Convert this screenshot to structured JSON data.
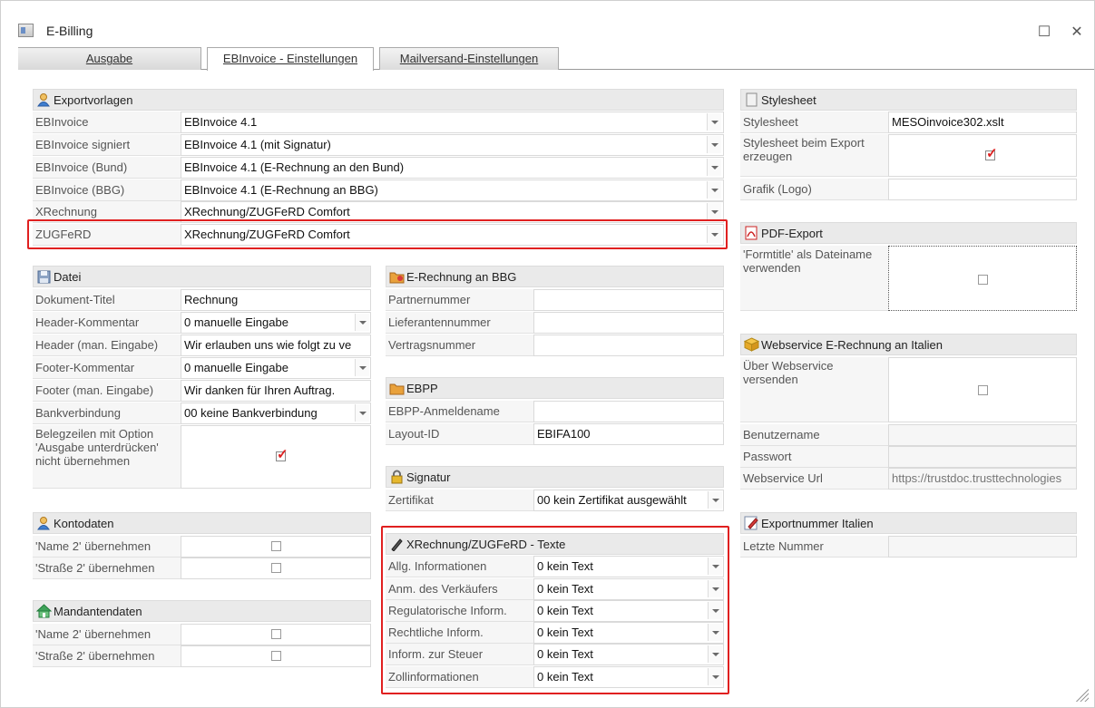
{
  "window": {
    "title": "E-Billing"
  },
  "tabs": [
    "Ausgabe",
    "EBInvoice - Einstellungen",
    "Mailversand-Einstellungen"
  ],
  "exportvorlagen": {
    "title": "Exportvorlagen",
    "rows": [
      {
        "label": "EBInvoice",
        "value": "EBInvoice 4.1"
      },
      {
        "label": "EBInvoice signiert",
        "value": "EBInvoice 4.1 (mit Signatur)"
      },
      {
        "label": "EBInvoice (Bund)",
        "value": "EBInvoice 4.1 (E-Rechnung an den Bund)"
      },
      {
        "label": "EBInvoice (BBG)",
        "value": "EBInvoice 4.1 (E-Rechnung an BBG)"
      },
      {
        "label": "XRechnung",
        "value": "XRechnung/ZUGFeRD Comfort"
      },
      {
        "label": "ZUGFeRD",
        "value": "XRechnung/ZUGFeRD Comfort"
      }
    ]
  },
  "datei": {
    "title": "Datei",
    "rows": [
      {
        "label": "Dokument-Titel",
        "value": "Rechnung"
      },
      {
        "label": "Header-Kommentar",
        "value": "0  manuelle Eingabe"
      },
      {
        "label": "Header (man. Eingabe)",
        "value": "Wir erlauben uns wie folgt zu ve"
      },
      {
        "label": "Footer-Kommentar",
        "value": "0  manuelle Eingabe"
      },
      {
        "label": "Footer (man. Eingabe)",
        "value": "Wir danken für Ihren Auftrag."
      },
      {
        "label": "Bankverbindung",
        "value": "00  keine Bankverbindung"
      },
      {
        "label": "Belegzeilen mit Option 'Ausgabe unterdrücken' nicht übernehmen",
        "checked": true
      }
    ]
  },
  "kontodaten": {
    "title": "Kontodaten",
    "rows": [
      {
        "label": "'Name 2' übernehmen",
        "checked": false
      },
      {
        "label": "'Straße 2' übernehmen",
        "checked": false
      }
    ]
  },
  "mandantendaten": {
    "title": "Mandantendaten",
    "rows": [
      {
        "label": "'Name 2' übernehmen",
        "checked": false
      },
      {
        "label": "'Straße 2' übernehmen",
        "checked": false
      }
    ]
  },
  "bbg": {
    "title": "E-Rechnung an BBG",
    "rows": [
      {
        "label": "Partnernummer",
        "value": ""
      },
      {
        "label": "Lieferantennummer",
        "value": ""
      },
      {
        "label": "Vertragsnummer",
        "value": ""
      }
    ]
  },
  "ebpp": {
    "title": "EBPP",
    "rows": [
      {
        "label": "EBPP-Anmeldename",
        "value": ""
      },
      {
        "label": "Layout-ID",
        "value": "EBIFA100"
      }
    ]
  },
  "signatur": {
    "title": "Signatur",
    "rows": [
      {
        "label": "Zertifikat",
        "value": "00 kein Zertifikat ausgewählt"
      }
    ]
  },
  "texte": {
    "title": "XRechnung/ZUGFeRD - Texte",
    "rows": [
      {
        "label": "Allg. Informationen",
        "value": "0  kein Text"
      },
      {
        "label": "Anm. des Verkäufers",
        "value": "0  kein Text"
      },
      {
        "label": "Regulatorische Inform.",
        "value": "0  kein Text"
      },
      {
        "label": "Rechtliche Inform.",
        "value": "0  kein Text"
      },
      {
        "label": "Inform. zur Steuer",
        "value": "0  kein Text"
      },
      {
        "label": "Zollinformationen",
        "value": "0  kein Text"
      }
    ]
  },
  "stylesheet": {
    "title": "Stylesheet",
    "rows": [
      {
        "label": "Stylesheet",
        "value": "MESOinvoice302.xslt"
      },
      {
        "label": "Stylesheet beim Export erzeugen",
        "checked": true
      },
      {
        "label": "Grafik (Logo)",
        "value": ""
      }
    ]
  },
  "pdf": {
    "title": "PDF-Export",
    "rows": [
      {
        "label": "'Formtitle' als Dateiname verwenden",
        "checked": false
      }
    ]
  },
  "italien": {
    "title": "Webservice E-Rechnung an Italien",
    "rows": [
      {
        "label": "Über Webservice versenden",
        "checked": false
      },
      {
        "label": "Benutzername",
        "value": ""
      },
      {
        "label": "Passwort",
        "value": ""
      },
      {
        "label": "Webservice Url",
        "value": "https://trustdoc.trusttechnologies"
      }
    ]
  },
  "exportnummer": {
    "title": "Exportnummer Italien",
    "rows": [
      {
        "label": "Letzte Nummer",
        "value": ""
      }
    ]
  },
  "colors": {
    "highlight": "#e02020",
    "header_bg": "#eaeaea",
    "label_bg": "#f6f6f6"
  }
}
